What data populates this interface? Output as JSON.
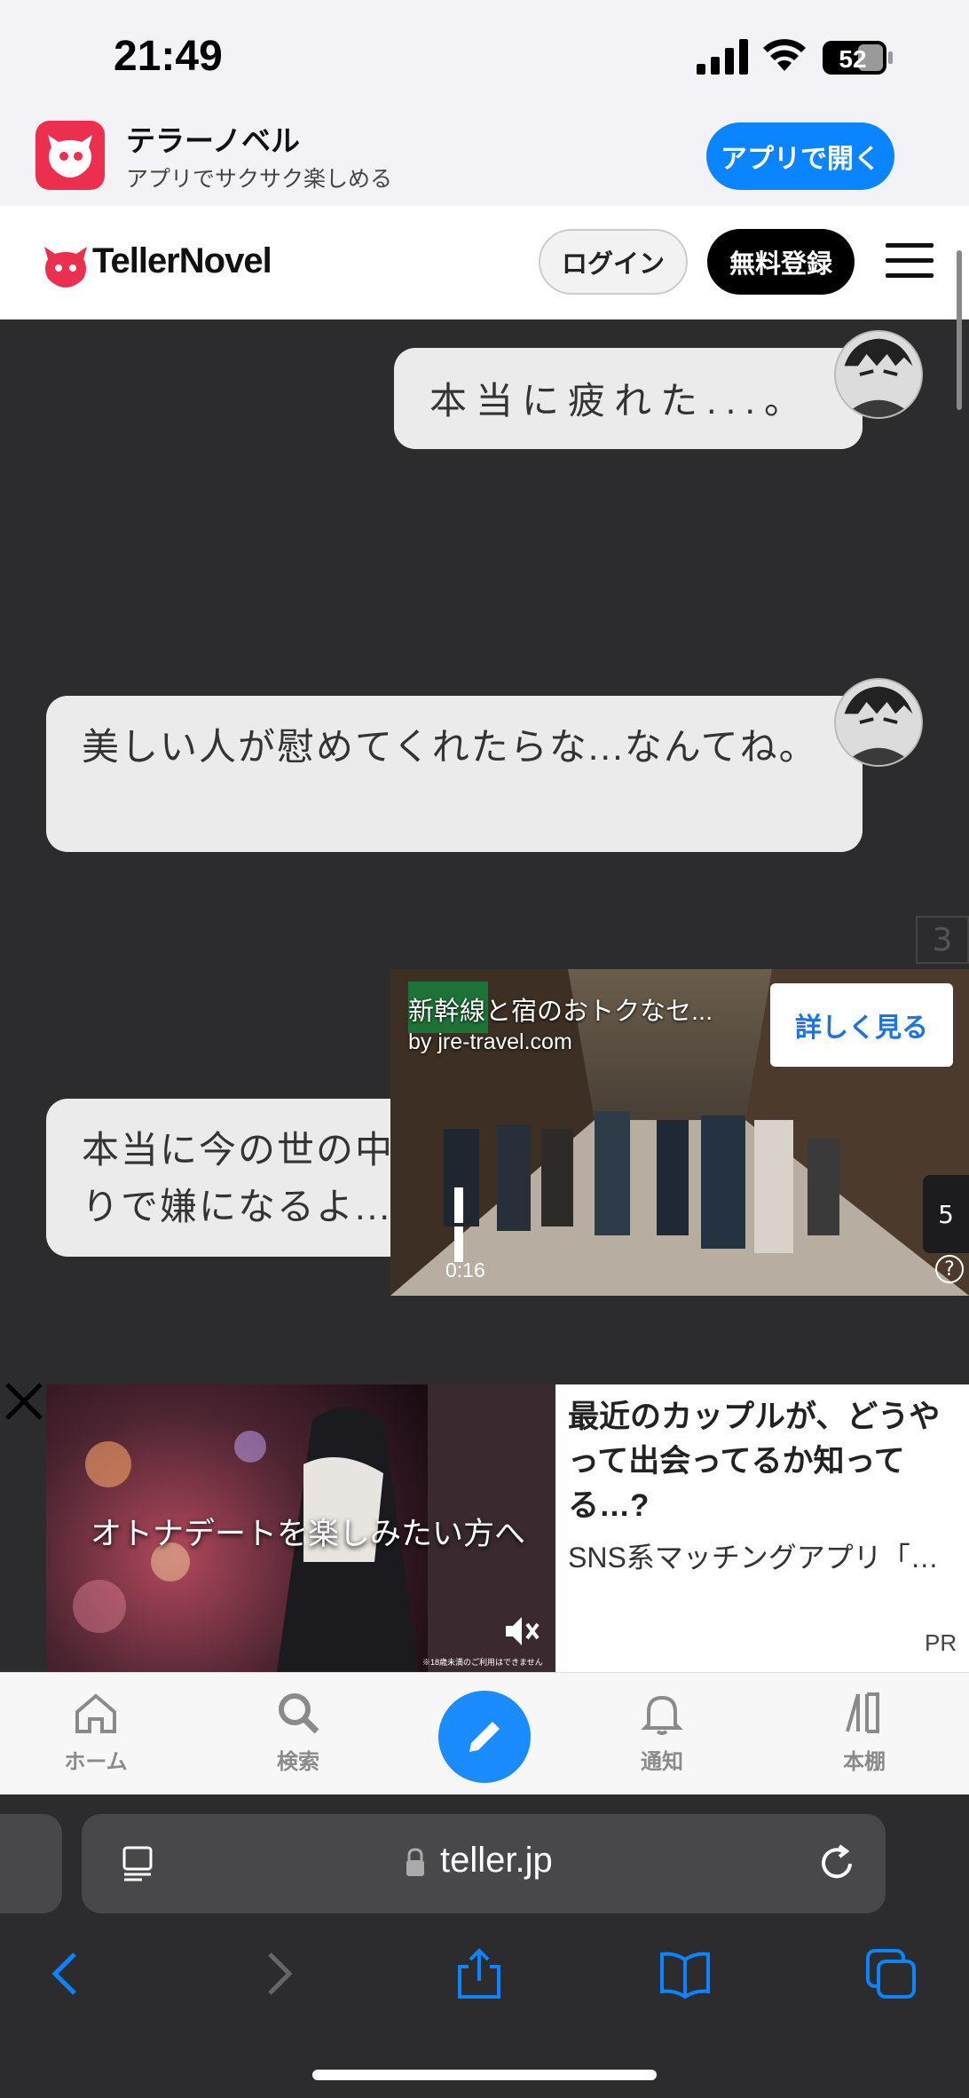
{
  "status_bar": {
    "time": "21:49",
    "battery": "52"
  },
  "app_banner": {
    "name": "テラーノベル",
    "subtitle": "アプリでサクサク楽しめる",
    "open_button": "アプリで開く"
  },
  "site_header": {
    "logo_text": "TellerNovel",
    "login_label": "ログイン",
    "signup_label": "無料登録"
  },
  "chat": {
    "messages": [
      {
        "text": "本当に疲れた...。"
      },
      {
        "text": "美しい人が慰めてくれたらな...なんてね。"
      },
      {
        "text": "本当に今の世の中\nりで嫌になるよ..."
      }
    ],
    "page_marker": "3"
  },
  "video_ad": {
    "title": "新幹線と宿のおトクなセ...",
    "by_line": "by jre-travel.com",
    "cta": "詳しく見る",
    "time": "0:16",
    "help": "?",
    "skip_counter": "5"
  },
  "banner_ad": {
    "image_text": "オトナデートを楽しみたい方へ",
    "small_note": "※18歳未満のご利用はできません",
    "title": "最近のカップルが、どうやって出会ってるか知ってる…?",
    "description": "SNS系マッチングアプリ「…",
    "pr_label": "PR"
  },
  "app_nav": {
    "items": [
      {
        "label": "ホーム",
        "icon": "home-icon"
      },
      {
        "label": "検索",
        "icon": "search-icon"
      },
      {
        "label": "",
        "icon": "pencil-icon"
      },
      {
        "label": "通知",
        "icon": "bell-icon"
      },
      {
        "label": "本棚",
        "icon": "bookshelf-icon"
      }
    ]
  },
  "safari": {
    "url": "teller.jp"
  },
  "colors": {
    "accent": "#0a84ff",
    "brand": "#ec2f4f",
    "chat_background": "#2c2c2e",
    "bubble": "#ebebeb"
  }
}
